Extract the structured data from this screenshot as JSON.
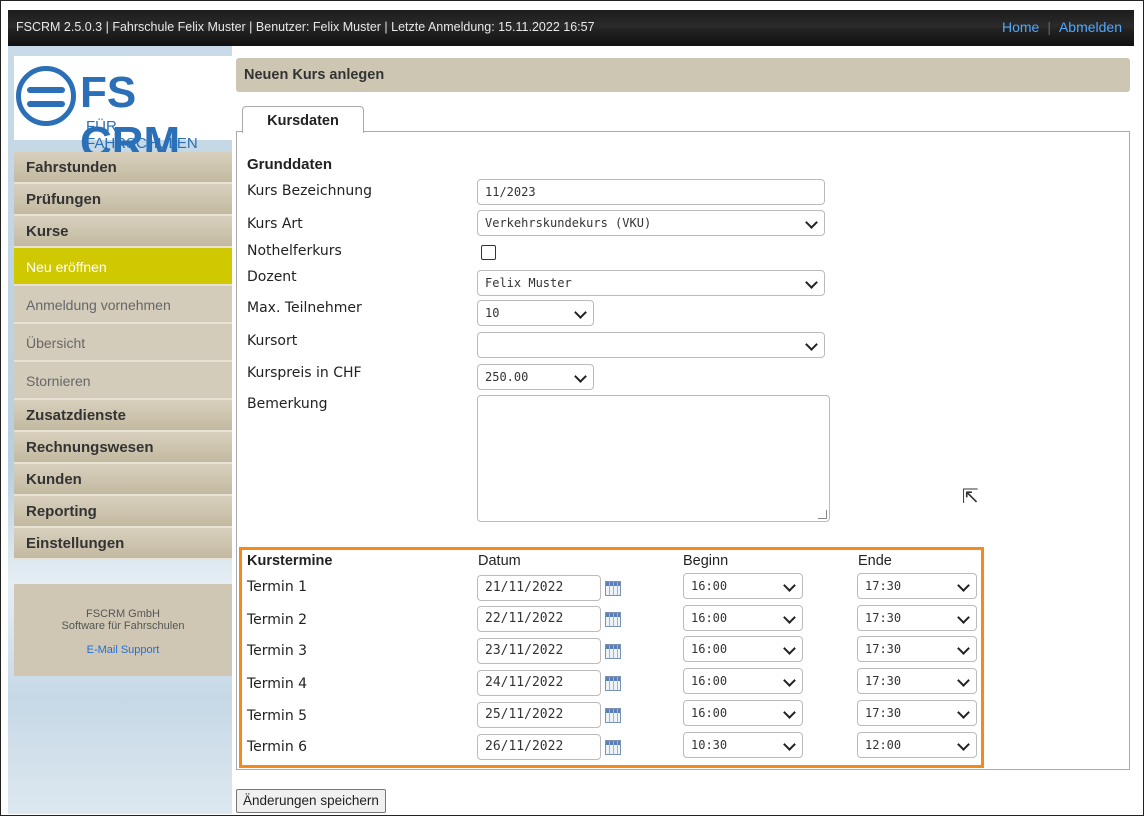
{
  "topbar": {
    "info": "FSCRM 2.5.0.3 | Fahrschule Felix Muster | Benutzer: Felix Muster | Letzte Anmeldung: 15.11.2022 16:57",
    "home": "Home",
    "logout": "Abmelden"
  },
  "logo": {
    "title": "FS CRM",
    "subtitle": "FÜR FAHRSCHULEN"
  },
  "sidebar": {
    "items": [
      {
        "label": "Fahrstunden"
      },
      {
        "label": "Prüfungen"
      },
      {
        "label": "Kurse"
      },
      {
        "label": "Neu eröffnen"
      },
      {
        "label": "Anmeldung vornehmen"
      },
      {
        "label": "Übersicht"
      },
      {
        "label": "Stornieren"
      },
      {
        "label": "Zusatzdienste"
      },
      {
        "label": "Rechnungswesen"
      },
      {
        "label": "Kunden"
      },
      {
        "label": "Reporting"
      },
      {
        "label": "Einstellungen"
      }
    ],
    "support": {
      "company": "FSCRM GmbH",
      "tagline": "Software für Fahrschulen",
      "email": "E-Mail Support"
    }
  },
  "page": {
    "title": "Neuen Kurs anlegen",
    "tab": "Kursdaten"
  },
  "grunddaten": {
    "title": "Grunddaten",
    "bezeichnung_label": "Kurs Bezeichnung",
    "bezeichnung_value": "11/2023",
    "art_label": "Kurs Art",
    "art_value": "Verkehrskundekurs (VKU)",
    "nothelfer_label": "Nothelferkurs",
    "dozent_label": "Dozent",
    "dozent_value": "Felix Muster",
    "max_label": "Max. Teilnehmer",
    "max_value": "10",
    "kursort_label": "Kursort",
    "kursort_value": "",
    "preis_label": "Kurspreis in CHF",
    "preis_value": "250.00",
    "bemerkung_label": "Bemerkung"
  },
  "kurstermine": {
    "title": "Kurstermine",
    "col_datum": "Datum",
    "col_beginn": "Beginn",
    "col_ende": "Ende",
    "rows": [
      {
        "label": "Termin 1",
        "datum": "21/11/2022",
        "beginn": "16:00",
        "ende": "17:30"
      },
      {
        "label": "Termin 2",
        "datum": "22/11/2022",
        "beginn": "16:00",
        "ende": "17:30"
      },
      {
        "label": "Termin 3",
        "datum": "23/11/2022",
        "beginn": "16:00",
        "ende": "17:30"
      },
      {
        "label": "Termin 4",
        "datum": "24/11/2022",
        "beginn": "16:00",
        "ende": "17:30"
      },
      {
        "label": "Termin 5",
        "datum": "25/11/2022",
        "beginn": "16:00",
        "ende": "17:30"
      },
      {
        "label": "Termin 6",
        "datum": "26/11/2022",
        "beginn": "10:30",
        "ende": "12:00"
      }
    ]
  },
  "actions": {
    "save": "Änderungen speichern"
  },
  "colors": {
    "highlight": "#f58a1c",
    "active_menu": "#d0c800",
    "brand": "#2b6fb6",
    "link": "#4fa8ff"
  }
}
